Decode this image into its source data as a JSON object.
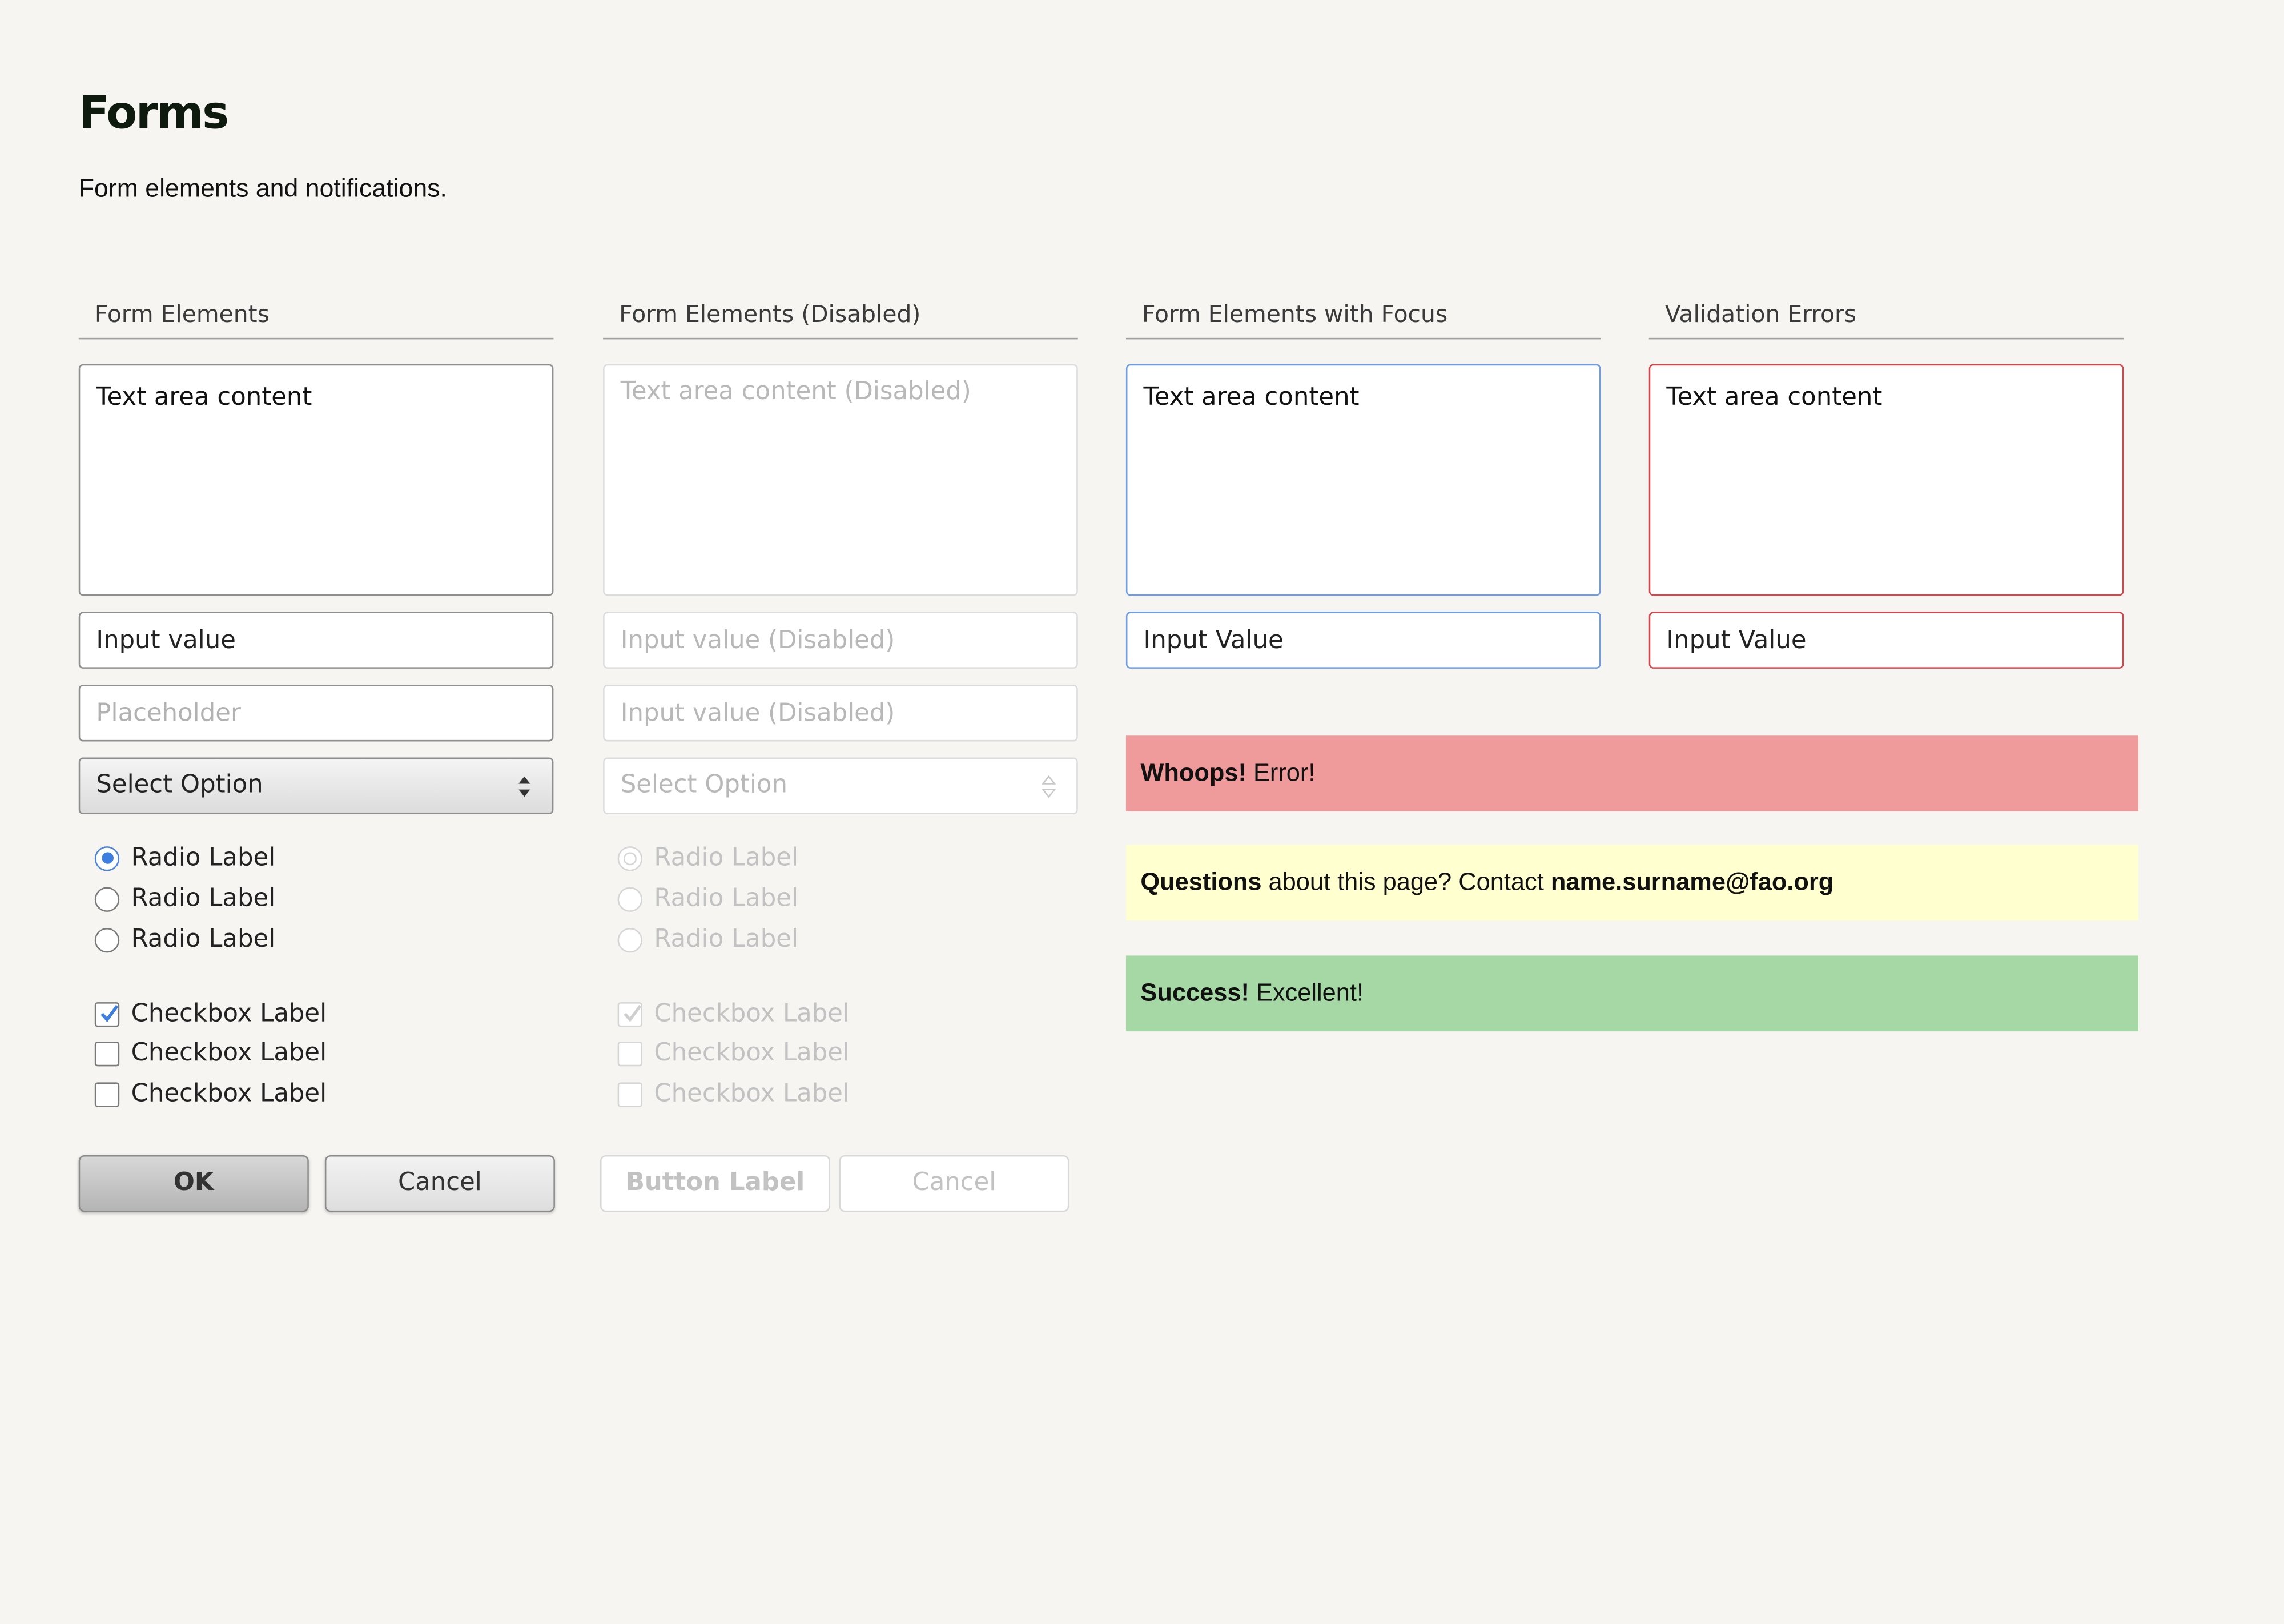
{
  "page": {
    "title": "Forms",
    "subtitle": "Form elements and notifications."
  },
  "columns": [
    {
      "heading": "Form Elements",
      "textarea": "Text area content",
      "input_value": "Input value",
      "input_placeholder": "Placeholder",
      "select_value": "Select Option",
      "radios": [
        {
          "label": "Radio Label",
          "checked": true
        },
        {
          "label": "Radio Label",
          "checked": false
        },
        {
          "label": "Radio Label",
          "checked": false
        }
      ],
      "checkboxes": [
        {
          "label": "Checkbox Label",
          "checked": true
        },
        {
          "label": "Checkbox Label",
          "checked": false
        },
        {
          "label": "Checkbox Label",
          "checked": false
        }
      ],
      "primary_button": "OK",
      "secondary_button": "Cancel"
    },
    {
      "heading": "Form Elements (Disabled)",
      "textarea_placeholder": "Text area content (Disabled)",
      "input_placeholder": "Input value (Disabled)",
      "input_value": "Input value (Disabled)",
      "select_value": "Select Option",
      "radios": [
        {
          "label": "Radio Label",
          "checked": true
        },
        {
          "label": "Radio Label",
          "checked": false
        },
        {
          "label": "Radio Label",
          "checked": false
        }
      ],
      "checkboxes": [
        {
          "label": "Checkbox Label",
          "checked": true
        },
        {
          "label": "Checkbox Label",
          "checked": false
        },
        {
          "label": "Checkbox Label",
          "checked": false
        }
      ],
      "primary_button": "Button Label",
      "secondary_button": "Cancel"
    },
    {
      "heading": "Form Elements with Focus",
      "textarea": "Text area content",
      "input_value": "Input Value"
    },
    {
      "heading": "Validation Errors",
      "textarea": "Text area content",
      "input_value": "Input Value"
    }
  ],
  "notifications": {
    "error": {
      "strong": "Whoops!",
      "text": "Error!",
      "color": "#f09b9b"
    },
    "info": {
      "strong": "Questions",
      "text": "about this page? Contact",
      "email": "name.surname@fao.org",
      "color": "#ffffcf"
    },
    "success": {
      "strong": "Success!",
      "text": "Excellent!",
      "color": "#a6d8a6"
    }
  },
  "colors": {
    "background": "#f6f5f2",
    "focus_border": "#6d9de6",
    "error_border": "#d6454a",
    "accent": "#3d7ee0"
  }
}
